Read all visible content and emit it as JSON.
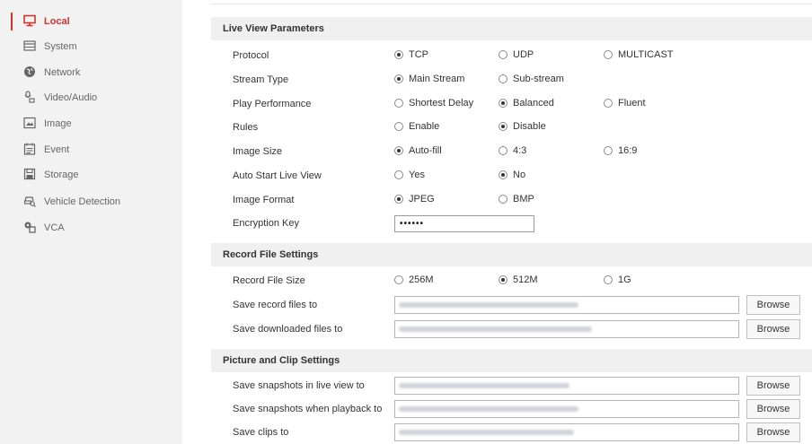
{
  "accent_color": "#d6312b",
  "sidebar": {
    "items": [
      {
        "label": "Local",
        "icon": "monitor-icon",
        "active": true
      },
      {
        "label": "System",
        "icon": "window-icon",
        "active": false
      },
      {
        "label": "Network",
        "icon": "globe-icon",
        "active": false
      },
      {
        "label": "Video/Audio",
        "icon": "camera-mic-icon",
        "active": false
      },
      {
        "label": "Image",
        "icon": "picture-icon",
        "active": false
      },
      {
        "label": "Event",
        "icon": "calendar-icon",
        "active": false
      },
      {
        "label": "Storage",
        "icon": "disk-icon",
        "active": false
      },
      {
        "label": "Vehicle Detection",
        "icon": "vehicle-search-icon",
        "active": false
      },
      {
        "label": "VCA",
        "icon": "vca-icon",
        "active": false
      }
    ]
  },
  "live_view": {
    "title": "Live View Parameters",
    "rows": [
      {
        "label": "Protocol",
        "options": [
          {
            "text": "TCP",
            "checked": true
          },
          {
            "text": "UDP",
            "checked": false
          },
          {
            "text": "MULTICAST",
            "checked": false
          }
        ]
      },
      {
        "label": "Stream Type",
        "options": [
          {
            "text": "Main Stream",
            "checked": true
          },
          {
            "text": "Sub-stream",
            "checked": false
          }
        ]
      },
      {
        "label": "Play Performance",
        "options": [
          {
            "text": "Shortest Delay",
            "checked": false
          },
          {
            "text": "Balanced",
            "checked": true
          },
          {
            "text": "Fluent",
            "checked": false
          }
        ]
      },
      {
        "label": "Rules",
        "options": [
          {
            "text": "Enable",
            "checked": false
          },
          {
            "text": "Disable",
            "checked": true
          }
        ]
      },
      {
        "label": "Image Size",
        "options": [
          {
            "text": "Auto-fill",
            "checked": true
          },
          {
            "text": "4:3",
            "checked": false
          },
          {
            "text": "16:9",
            "checked": false
          }
        ]
      },
      {
        "label": "Auto Start Live View",
        "options": [
          {
            "text": "Yes",
            "checked": false
          },
          {
            "text": "No",
            "checked": true
          }
        ]
      },
      {
        "label": "Image Format",
        "options": [
          {
            "text": "JPEG",
            "checked": true
          },
          {
            "text": "BMP",
            "checked": false
          }
        ]
      }
    ],
    "encryption": {
      "label": "Encryption Key",
      "value": "••••••"
    }
  },
  "record_file": {
    "title": "Record File Settings",
    "size": {
      "label": "Record File Size",
      "options": [
        {
          "text": "256M",
          "checked": false
        },
        {
          "text": "512M",
          "checked": true
        },
        {
          "text": "1G",
          "checked": false
        }
      ]
    },
    "paths": [
      {
        "label": "Save record files to",
        "button": "Browse"
      },
      {
        "label": "Save downloaded files to",
        "button": "Browse"
      }
    ]
  },
  "picture_clip": {
    "title": "Picture and Clip Settings",
    "paths": [
      {
        "label": "Save snapshots in live view to",
        "button": "Browse"
      },
      {
        "label": "Save snapshots when playback to",
        "button": "Browse"
      },
      {
        "label": "Save clips to",
        "button": "Browse"
      }
    ]
  }
}
